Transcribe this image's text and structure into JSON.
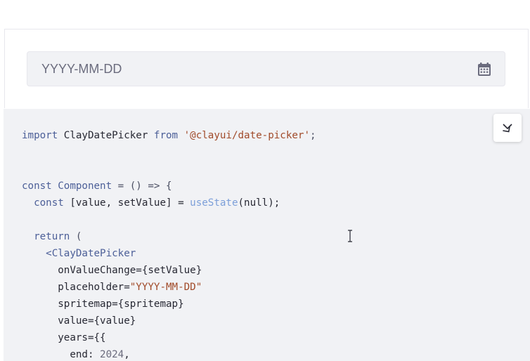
{
  "date_picker": {
    "placeholder": "YYYY-MM-DD",
    "calendar_icon": "calendar-icon"
  },
  "code_block": {
    "collapse_icon": "collapse-chevrons-icon",
    "lines": [
      [
        {
          "t": "import",
          "c": "kw"
        },
        {
          "t": " ClayDatePicker ",
          "c": ""
        },
        {
          "t": "from",
          "c": "kw"
        },
        {
          "t": " ",
          "c": ""
        },
        {
          "t": "'@clayui/date-picker'",
          "c": "str"
        },
        {
          "t": ";",
          "c": "punc"
        }
      ],
      [],
      [],
      [
        {
          "t": "const",
          "c": "kw"
        },
        {
          "t": " ",
          "c": ""
        },
        {
          "t": "Component",
          "c": "fn"
        },
        {
          "t": " = () => {",
          "c": "punc"
        }
      ],
      [
        {
          "t": "  const",
          "c": "kw"
        },
        {
          "t": " [value, setValue] = ",
          "c": ""
        },
        {
          "t": "useState",
          "c": "hook"
        },
        {
          "t": "(null);",
          "c": ""
        }
      ],
      [],
      [
        {
          "t": "  return",
          "c": "kw"
        },
        {
          "t": " (",
          "c": "punc"
        }
      ],
      [
        {
          "t": "    <ClayDatePicker",
          "c": "fn"
        }
      ],
      [
        {
          "t": "      onValueChange={setValue}",
          "c": ""
        }
      ],
      [
        {
          "t": "      placeholder=",
          "c": ""
        },
        {
          "t": "\"YYYY-MM-DD\"",
          "c": "str"
        }
      ],
      [
        {
          "t": "      spritemap={spritemap}",
          "c": ""
        }
      ],
      [
        {
          "t": "      value={value}",
          "c": ""
        }
      ],
      [
        {
          "t": "      years={{",
          "c": ""
        }
      ],
      [
        {
          "t": "        end: ",
          "c": ""
        },
        {
          "t": "2024",
          "c": "num"
        },
        {
          "t": ",",
          "c": ""
        }
      ]
    ]
  },
  "colors": {
    "input_bg": "#f1f2f5",
    "code_bg": "#f1f2f5",
    "keyword": "#4c5f98",
    "string": "#a14b2a"
  }
}
